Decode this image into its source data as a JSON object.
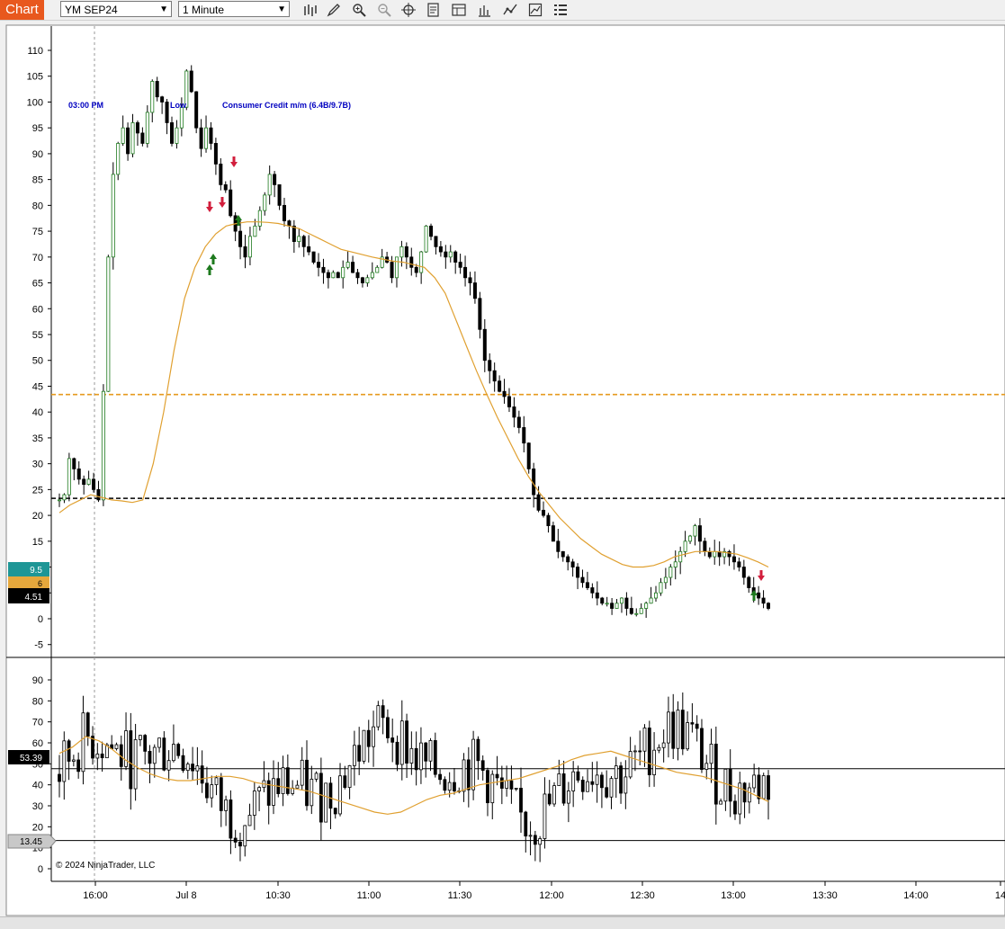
{
  "toolbar": {
    "tab_label": "Chart",
    "instrument": "YM SEP24",
    "interval": "1 Minute",
    "icons": [
      "bar-type-icon",
      "drawing-tool-icon",
      "zoom-in-icon",
      "zoom-out-icon",
      "crosshair-icon",
      "data-box-icon",
      "templates-icon",
      "bar-style-icon",
      "indicators-icon",
      "strategies-icon",
      "properties-icon"
    ]
  },
  "chart_data": [
    {
      "type": "candlestick",
      "pane": "price",
      "y_ticks": [
        110,
        105,
        100,
        95,
        90,
        85,
        80,
        75,
        70,
        65,
        60,
        55,
        50,
        45,
        40,
        35,
        30,
        25,
        20,
        15,
        10,
        5,
        0,
        -5
      ],
      "ylim": [
        -7,
        112
      ],
      "x_ticks": [
        "16:00",
        "Jul 8",
        "10:30",
        "11:00",
        "11:30",
        "12:00",
        "12:30",
        "13:00",
        "13:30",
        "14:00",
        "14"
      ],
      "horizontal_lines": [
        {
          "value": 43.4,
          "color": "#e69a1e",
          "style": "dashed"
        },
        {
          "value": 23.3,
          "color": "#000000",
          "style": "dashed"
        }
      ],
      "annotations": [
        {
          "text": "03:00 PM",
          "color": "#0000c0"
        },
        {
          "text": "Low",
          "color": "#0000c0"
        },
        {
          "text": "Consumer Credit m/m (6.4B/9.7B)",
          "color": "#0000c0"
        }
      ],
      "price_markers": [
        {
          "label": "9.5",
          "value": 9.5,
          "color": "#1e9696"
        },
        {
          "label": "6",
          "value": 6.3,
          "color": "#e6a83c"
        },
        {
          "label": "4.51",
          "value": 4.51,
          "color": "#000000"
        }
      ],
      "close_series": [
        23,
        24,
        31,
        29,
        27,
        26,
        27,
        25,
        23,
        44,
        70,
        86,
        92,
        95,
        90,
        96,
        94,
        92,
        98,
        104,
        101,
        100,
        96,
        92,
        95,
        99,
        106,
        102,
        95,
        91,
        95,
        92,
        88,
        84,
        83,
        78,
        75,
        72,
        70,
        74,
        76,
        79,
        82,
        86,
        84,
        80,
        77,
        76,
        73,
        74,
        72,
        71,
        69,
        68,
        67,
        66,
        67,
        66,
        68,
        69,
        67,
        66,
        65,
        66,
        67,
        68,
        70,
        69,
        66,
        70,
        72,
        70,
        68,
        67,
        71,
        76,
        74,
        72,
        71,
        70,
        71,
        69,
        68,
        66,
        65,
        62,
        56,
        50,
        48,
        46,
        44,
        43,
        41,
        39,
        37,
        34,
        29,
        24,
        21,
        20,
        18,
        15,
        13,
        12,
        11,
        10,
        8,
        7,
        6,
        5,
        4,
        3,
        3,
        2,
        3,
        4,
        2,
        1,
        1,
        2,
        3,
        4,
        5,
        7,
        8,
        10,
        11,
        13,
        15,
        16,
        18,
        15,
        13,
        12,
        13,
        12,
        13,
        12,
        11,
        10,
        8,
        6,
        5,
        4,
        3,
        2
      ],
      "moving_average": {
        "color": "#e0a030",
        "values": [
          20.5,
          22,
          23,
          24,
          23.5,
          23,
          22.8,
          22.5,
          23,
          30,
          40,
          52,
          62,
          68,
          72,
          74.5,
          76,
          76.5,
          76.8,
          76.8,
          76.7,
          76.5,
          76,
          75.5,
          74.5,
          73.5,
          72.5,
          71.5,
          71,
          70.5,
          70,
          69.6,
          69.2,
          69,
          68.5,
          68,
          66,
          63,
          58,
          53,
          48,
          43.4,
          39,
          35,
          31,
          27.5,
          24.5,
          22,
          19.5,
          17.5,
          15.5,
          14,
          12.5,
          11.5,
          10.5,
          10,
          10,
          10.3,
          11,
          12,
          12.5,
          13,
          13,
          13,
          12.8,
          12.5,
          11.8,
          11,
          10
        ]
      }
    },
    {
      "type": "candlestick",
      "pane": "indicator",
      "y_ticks": [
        90,
        80,
        70,
        60,
        50,
        40,
        30,
        20,
        10,
        0
      ],
      "ylim": [
        -3,
        97
      ],
      "horizontal_lines": [
        {
          "value": 47.7,
          "color": "#000000"
        },
        {
          "value": 13.45,
          "color": "#000000"
        }
      ],
      "price_markers": [
        {
          "label": "53.39",
          "value": 53.39,
          "color": "#000000"
        },
        {
          "label": "13.45",
          "value": 13.45,
          "color": "#c8c8c8"
        }
      ],
      "moving_average": {
        "color": "#e0a030",
        "values": [
          55,
          58,
          63,
          61,
          57,
          52,
          48,
          45,
          43,
          42,
          42,
          43,
          44,
          44,
          43,
          41,
          40,
          39,
          38,
          37,
          35,
          33,
          31,
          29,
          27,
          26,
          27,
          30,
          33,
          35,
          36,
          38,
          40,
          41,
          42,
          43,
          45,
          47,
          49,
          52,
          54,
          55,
          56,
          54,
          52,
          50,
          48,
          46,
          45,
          44,
          42,
          40,
          38,
          35,
          32
        ]
      }
    }
  ],
  "copyright": "© 2024 NinjaTrader, LLC"
}
